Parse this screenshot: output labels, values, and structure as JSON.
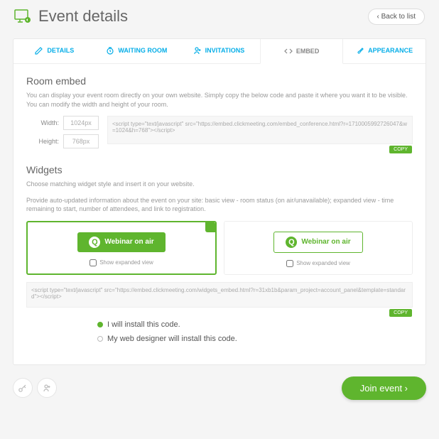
{
  "header": {
    "title": "Event details",
    "back": "‹ Back to list"
  },
  "tabs": {
    "details": "DETAILS",
    "waiting": "WAITING ROOM",
    "invitations": "INVITATIONS",
    "embed": "EMBED",
    "appearance": "APPEARANCE"
  },
  "embed": {
    "title": "Room embed",
    "desc": "You can display your event room directly on your own website. Simply copy the below code and paste it where you want it to be visible. You can modify the width and height of your room.",
    "width_label": "Width:",
    "width_value": "1024px",
    "height_label": "Height:",
    "height_value": "768px",
    "code": "<script type=\"text/javascript\" src=\"https://embed.clickmeeting.com/embed_conference.html?r=1710005992726047&w=1024&h=768\"></script>",
    "copy": "COPY"
  },
  "widgets": {
    "title": "Widgets",
    "desc1": "Choose matching widget style and insert it on your website.",
    "desc2": "Provide auto-updated information about the event on your site: basic view - room status (on air/unavailable); expanded view - time remaining to start, number of attendees, and link to registration.",
    "btn_label": "Webinar on air",
    "expanded": "Show expanded view",
    "code": "<script type=\"text/javascript\" src=\"https://embed.clickmeeting.com/widgets_embed.html?r=31xb1b&param_project=account_panel&template=standard\"></script>",
    "copy": "COPY"
  },
  "install": {
    "opt1": "I will install this code.",
    "opt2": "My web designer will install this code."
  },
  "footer": {
    "join": "Join event  ›"
  }
}
